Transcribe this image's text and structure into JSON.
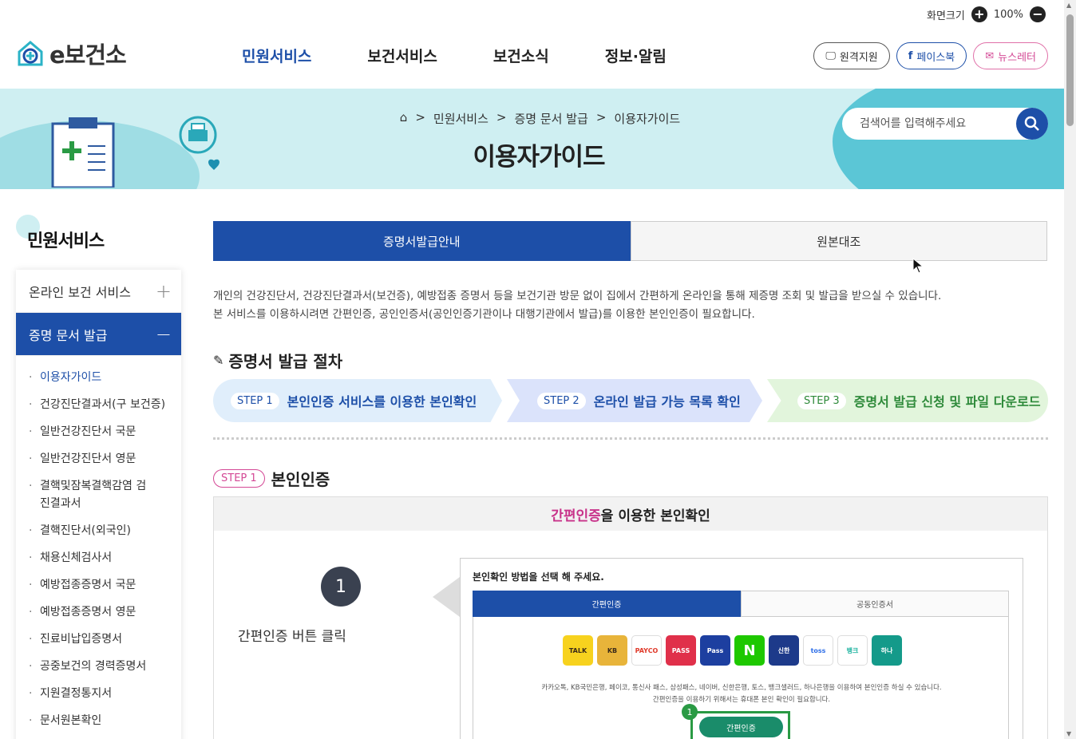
{
  "topbar": {
    "zoom_label": "화면크기",
    "zoom_value": "100%"
  },
  "logo": {
    "text": "e보건소"
  },
  "gnb": [
    "민원서비스",
    "보건서비스",
    "보건소식",
    "정보·알림"
  ],
  "ext_links": [
    "원격지원",
    "페이스북",
    "뉴스레터"
  ],
  "breadcrumb": [
    "민원서비스",
    "증명 문서 발급",
    "이용자가이드"
  ],
  "page_title": "이용자가이드",
  "search": {
    "placeholder": "검색어를 입력해주세요"
  },
  "sidebar": {
    "title": "민원서비스",
    "items": [
      "온라인 보건 서비스",
      "증명 문서 발급"
    ],
    "subitems": [
      "이용자가이드",
      "건강진단결과서(구 보건증)",
      "일반건강진단서 국문",
      "일반건강진단서 영문",
      "결핵및잠복결핵감염 검진결과서",
      "결핵진단서(외국인)",
      "채용신체검사서",
      "예방접종증명서 국문",
      "예방접종증명서 영문",
      "진료비납입증명서",
      "공중보건의 경력증명서",
      "지원결정통지서",
      "문서원본확인"
    ]
  },
  "tabs": [
    "증명서발급안내",
    "원본대조"
  ],
  "intro": [
    "개인의 건강진단서, 건강진단결과서(보건증), 예방접종 증명서 등을 보건기관 방문 없이 집에서 간편하게 온라인을 통해 제증명 조회 및 발급을 받으실 수 있습니다.",
    "본 서비스를 이용하시려면 간편인증, 공인인증서(공인인증기관이나 대행기관에서 발급)를 이용한 본인인증이 필요합니다."
  ],
  "section_title": "증명서 발급 절차",
  "steps": [
    {
      "badge": "STEP 1",
      "label": "본인인증 서비스를 이용한 본인확인"
    },
    {
      "badge": "STEP 2",
      "label": "온라인 발급 가능 목록 확인"
    },
    {
      "badge": "STEP 3",
      "label": "증명서 발급 신청 및 파일 다운로드"
    }
  ],
  "step_section": {
    "badge": "STEP 1",
    "title": "본인인증"
  },
  "guide": {
    "head_pink": "간편인증",
    "head_rest": "을 이용한 본인확인",
    "num": "1",
    "desc": "간편인증 버튼 클릭",
    "mock_title": "본인확인 방법을 선택 해 주세요.",
    "mock_tabs": [
      "간편인증",
      "공동인증서"
    ],
    "providers": [
      "TALK",
      "KB",
      "PAYCO",
      "PASS",
      "Pass",
      "N",
      "신한",
      "toss",
      "뱅크",
      "하나"
    ],
    "note1": "카카오톡, KB국민은행, 페이코, 통신사 패스, 삼성패스, 네이버, 신한은행, 토스, 뱅크샐러드, 하나은행을 이용하여 본인인증 하실 수 있습니다.",
    "note2": "간편인증을 이용하기 위해서는 휴대폰 본인 확인이 필요합니다.",
    "btn_badge": "1",
    "btn": "간편인증"
  },
  "colors": {
    "primary": "#1d4fa8",
    "banner": "#cfeff2",
    "pink": "#c8338a",
    "green": "#2e8a3a"
  }
}
